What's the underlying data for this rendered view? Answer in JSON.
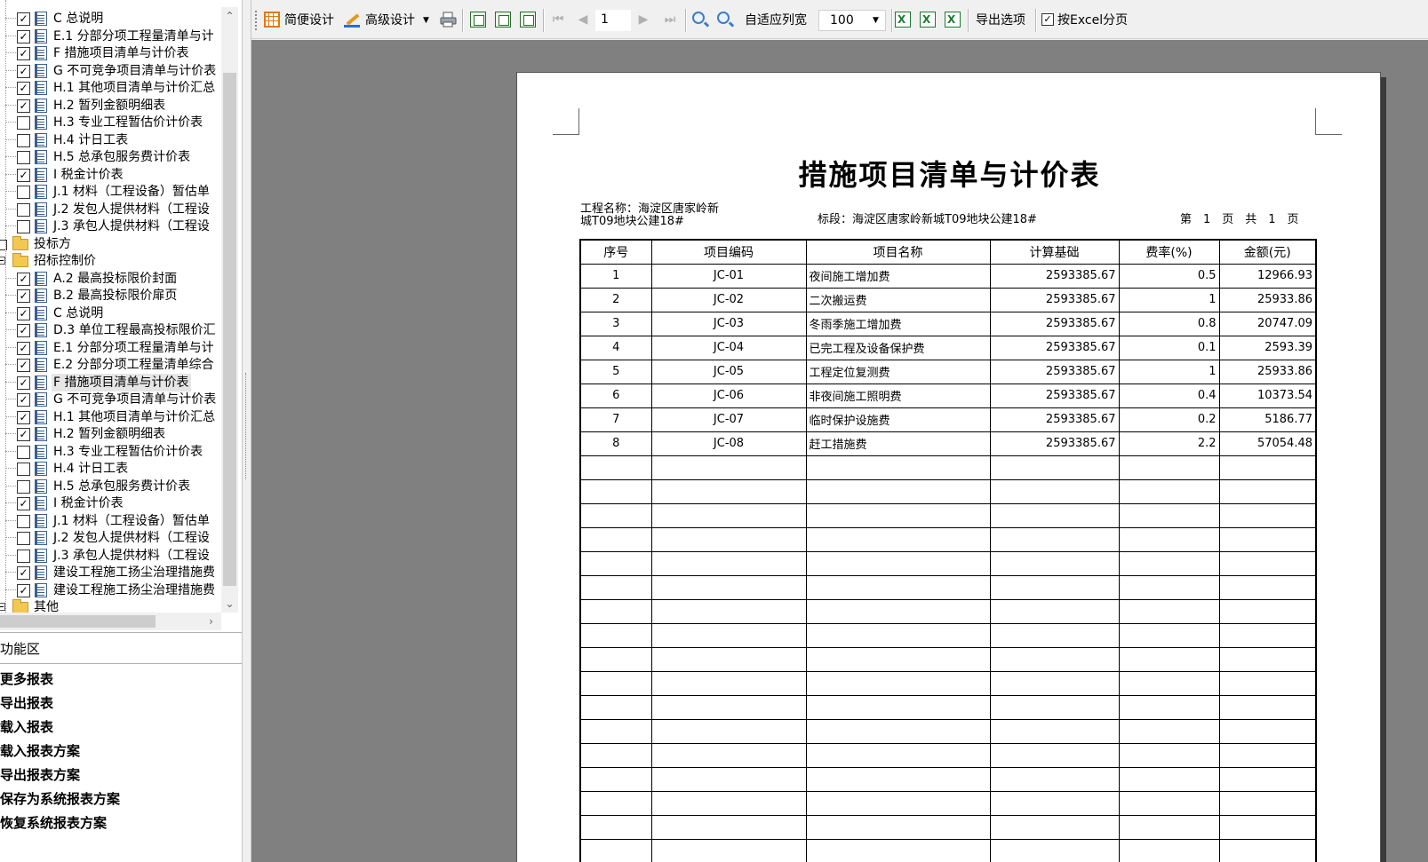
{
  "tree": {
    "rows": [
      {
        "checked": true,
        "label": "C 总说明"
      },
      {
        "checked": true,
        "label": "E.1 分部分项工程量清单与计"
      },
      {
        "checked": true,
        "label": "F 措施项目清单与计价表"
      },
      {
        "checked": true,
        "label": "G 不可竞争项目清单与计价表"
      },
      {
        "checked": true,
        "label": "H.1 其他项目清单与计价汇总"
      },
      {
        "checked": true,
        "label": "H.2 暂列金额明细表"
      },
      {
        "checked": false,
        "label": "H.3 专业工程暂估价计价表"
      },
      {
        "checked": false,
        "label": "H.4 计日工表"
      },
      {
        "checked": false,
        "label": "H.5 总承包服务费计价表"
      },
      {
        "checked": true,
        "label": "I 税金计价表"
      },
      {
        "checked": false,
        "label": "J.1 材料（工程设备）暂估单"
      },
      {
        "checked": false,
        "label": "J.2 发包人提供材料（工程设"
      },
      {
        "checked": false,
        "label": "J.3 承包人提供材料（工程设"
      },
      {
        "folder": true,
        "label": "投标方"
      },
      {
        "folder": true,
        "expand": true,
        "label": "招标控制价"
      },
      {
        "checked": true,
        "label": "A.2 最高投标限价封面"
      },
      {
        "checked": true,
        "label": "B.2 最高投标限价扉页"
      },
      {
        "checked": true,
        "label": "C 总说明"
      },
      {
        "checked": true,
        "label": "D.3 单位工程最高投标限价汇"
      },
      {
        "checked": true,
        "label": "E.1 分部分项工程量清单与计"
      },
      {
        "checked": true,
        "label": "E.2 分部分项工程量清单综合"
      },
      {
        "checked": true,
        "label": "F 措施项目清单与计价表",
        "selected": true
      },
      {
        "checked": true,
        "label": "G 不可竞争项目清单与计价表"
      },
      {
        "checked": true,
        "label": "H.1 其他项目清单与计价汇总"
      },
      {
        "checked": true,
        "label": "H.2 暂列金额明细表"
      },
      {
        "checked": false,
        "label": "H.3 专业工程暂估价计价表"
      },
      {
        "checked": false,
        "label": "H.4 计日工表"
      },
      {
        "checked": false,
        "label": "H.5 总承包服务费计价表"
      },
      {
        "checked": true,
        "label": "I 税金计价表"
      },
      {
        "checked": false,
        "label": "J.1 材料（工程设备）暂估单"
      },
      {
        "checked": false,
        "label": "J.2 发包人提供材料（工程设"
      },
      {
        "checked": false,
        "label": "J.3 承包人提供材料（工程设"
      },
      {
        "checked": true,
        "label": "建设工程施工扬尘治理措施费"
      },
      {
        "checked": true,
        "label": "建设工程施工扬尘治理措施费"
      },
      {
        "folder": true,
        "expand": true,
        "label": "其他"
      }
    ]
  },
  "func_panel": {
    "header": "功能区",
    "items": [
      "更多报表",
      "导出报表",
      "载入报表",
      "载入报表方案",
      "导出报表方案",
      "保存为系统报表方案",
      "恢复系统报表方案"
    ]
  },
  "toolbar": {
    "simple_design": "简便设计",
    "advanced_design": "高级设计",
    "page_input": "1",
    "auto_fit_cols": "自适应列宽",
    "zoom_value": "100",
    "export_options": "导出选项",
    "excel_paging": "按Excel分页",
    "excel_paging_checked": true
  },
  "report": {
    "title": "措施项目清单与计价表",
    "project_name_line1": "工程名称：海淀区唐家岭新",
    "project_name_line2": "城T09地块公建18#",
    "section": "标段：海淀区唐家岭新城T09地块公建18#",
    "page_info": "第　1　页　共　1　页",
    "columns": [
      "序号",
      "项目编码",
      "项目名称",
      "计算基础",
      "费率(%)",
      "金额(元)"
    ],
    "rows": [
      {
        "no": "1",
        "code": "JC-01",
        "name": "夜间施工增加费",
        "base": "2593385.67",
        "rate": "0.5",
        "amount": "12966.93"
      },
      {
        "no": "2",
        "code": "JC-02",
        "name": "二次搬运费",
        "base": "2593385.67",
        "rate": "1",
        "amount": "25933.86"
      },
      {
        "no": "3",
        "code": "JC-03",
        "name": "冬雨季施工增加费",
        "base": "2593385.67",
        "rate": "0.8",
        "amount": "20747.09"
      },
      {
        "no": "4",
        "code": "JC-04",
        "name": "已完工程及设备保护费",
        "base": "2593385.67",
        "rate": "0.1",
        "amount": "2593.39"
      },
      {
        "no": "5",
        "code": "JC-05",
        "name": "工程定位复测费",
        "base": "2593385.67",
        "rate": "1",
        "amount": "25933.86"
      },
      {
        "no": "6",
        "code": "JC-06",
        "name": "非夜间施工照明费",
        "base": "2593385.67",
        "rate": "0.4",
        "amount": "10373.54"
      },
      {
        "no": "7",
        "code": "JC-07",
        "name": "临时保护设施费",
        "base": "2593385.67",
        "rate": "0.2",
        "amount": "5186.77"
      },
      {
        "no": "8",
        "code": "JC-08",
        "name": "赶工措施费",
        "base": "2593385.67",
        "rate": "2.2",
        "amount": "57054.48"
      }
    ]
  }
}
